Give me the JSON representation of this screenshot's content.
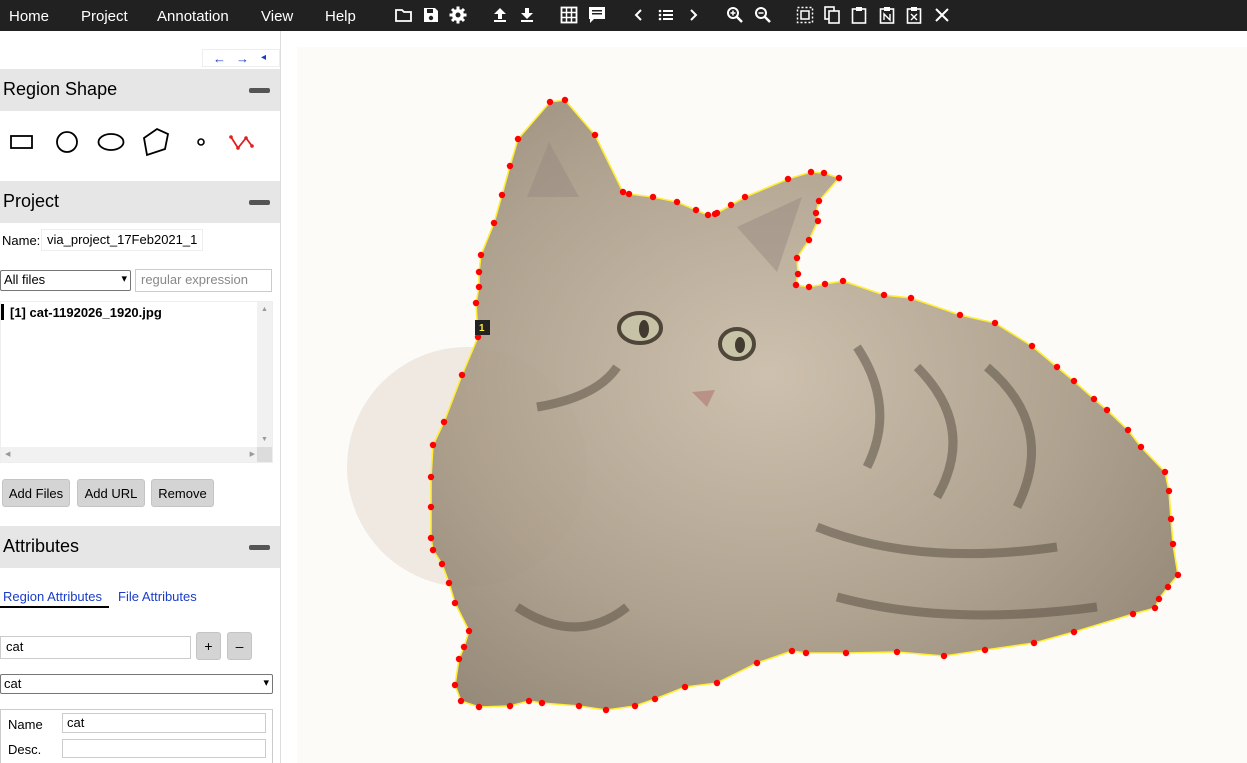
{
  "menu": {
    "home": "Home",
    "project": "Project",
    "annotation": "Annotation",
    "view": "View",
    "help": "Help"
  },
  "toolbar_icons": [
    "folder-open-icon",
    "save-icon",
    "settings-icon",
    "upload-icon",
    "download-icon",
    "grid-view-icon",
    "comment-icon",
    "chevron-left-icon",
    "list-icon",
    "chevron-right-icon",
    "zoom-in-icon",
    "zoom-out-icon",
    "select-all-icon",
    "copy-icon",
    "paste-icon",
    "paste-n-icon",
    "delete-icon",
    "close-icon"
  ],
  "nav": {
    "prev": "←",
    "next": "→",
    "collapse": "◂"
  },
  "region_shape": {
    "title": "Region Shape",
    "shapes": [
      "rectangle",
      "circle",
      "ellipse",
      "polygon",
      "point",
      "polyline"
    ]
  },
  "project": {
    "title": "Project",
    "name_label": "Name:",
    "name_value": "via_project_17Feb2021_1",
    "filter_select": "All files",
    "regex_placeholder": "regular expression",
    "files": [
      "[1] cat-1192026_1920.jpg"
    ],
    "buttons": {
      "add_files": "Add Files",
      "add_url": "Add URL",
      "remove": "Remove"
    }
  },
  "attributes": {
    "title": "Attributes",
    "tabs": {
      "region": "Region Attributes",
      "file": "File Attributes"
    },
    "attr_input": "cat",
    "add_btn": "+",
    "remove_btn": "–",
    "attr_select": "cat",
    "name_label": "Name",
    "name_value": "cat",
    "desc_label": "Desc.",
    "desc_value": ""
  },
  "canvas": {
    "image_name": "cat-1192026_1920.jpg",
    "region_label": "1",
    "region_line_color": "#ffee33",
    "vertex_color": "#ff0000",
    "overlay_color": "#b4a896"
  }
}
